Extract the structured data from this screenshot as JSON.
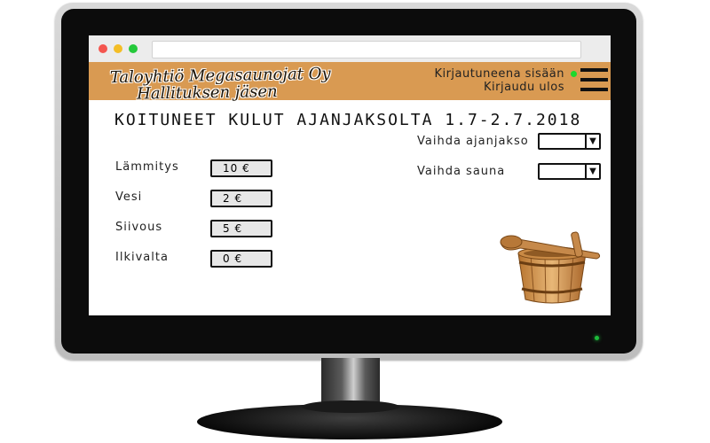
{
  "browser": {
    "address": ""
  },
  "header": {
    "brand_line1": "Taloyhtiö Megasaunojat Oy",
    "brand_line2": "Hallituksen jäsen",
    "status_text": "Kirjautuneena sisään",
    "logout_text": "Kirjaudu ulos",
    "online_color": "#1cd92c",
    "menu_icon": "hamburger-menu-icon"
  },
  "main": {
    "title": "KOITUNEET KULUT AJANJAKSOLTA 1.7-2.7.2018",
    "costs": [
      {
        "label": "Lämmitys",
        "value": "10 €"
      },
      {
        "label": "Vesi",
        "value": "2 €"
      },
      {
        "label": "Siivous",
        "value": "5 €"
      },
      {
        "label": "Ilkivalta",
        "value": "0 €"
      }
    ],
    "filters": {
      "period_label": "Vaihda ajanjakso",
      "period_value": "",
      "sauna_label": "Vaihda sauna",
      "sauna_value": "",
      "dropdown_icon": "dropdown-arrow-icon"
    },
    "illustration": "sauna-bucket-image"
  },
  "colors": {
    "header_bg": "#d99a52",
    "value_box_bg": "#e7e7e7"
  }
}
